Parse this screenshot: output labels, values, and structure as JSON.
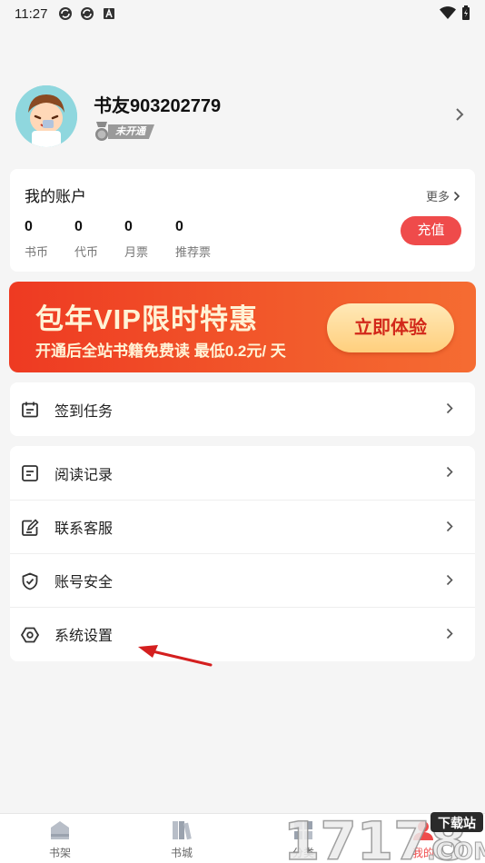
{
  "status_bar": {
    "time": "11:27",
    "icons": [
      "sync-icon",
      "sync-icon",
      "a-icon"
    ],
    "right_icons": [
      "wifi-icon",
      "battery-icon"
    ]
  },
  "profile": {
    "username": "书友903202779",
    "vip_status": "未开通"
  },
  "account": {
    "title": "我的账户",
    "more": "更多",
    "stats": [
      {
        "value": "0",
        "label": "书币"
      },
      {
        "value": "0",
        "label": "代币"
      },
      {
        "value": "0",
        "label": "月票"
      },
      {
        "value": "0",
        "label": "推荐票"
      }
    ],
    "recharge_label": "充值"
  },
  "banner": {
    "title": "包年VIP限时特惠",
    "subtitle": "开通后全站书籍免费读 最低0.2元/ 天",
    "button": "立即体验"
  },
  "signin": {
    "label": "签到任务"
  },
  "menu": [
    {
      "label": "阅读记录",
      "icon": "reading-record-icon"
    },
    {
      "label": "联系客服",
      "icon": "edit-icon"
    },
    {
      "label": "账号安全",
      "icon": "shield-check-icon"
    },
    {
      "label": "系统设置",
      "icon": "settings-icon"
    }
  ],
  "bottom_nav": [
    {
      "label": "书架",
      "icon": "bookshelf-icon"
    },
    {
      "label": "书城",
      "icon": "bookstore-icon"
    },
    {
      "label": "分类",
      "icon": "category-icon"
    },
    {
      "label": "我的",
      "icon": "profile-icon"
    }
  ],
  "watermark": {
    "digits": "17178",
    "tag": "下载站",
    "suffix": ".COM"
  },
  "colors": {
    "accent": "#ef4b4b",
    "banner": "#ee3a22",
    "banner_text": "#fff3d6"
  }
}
